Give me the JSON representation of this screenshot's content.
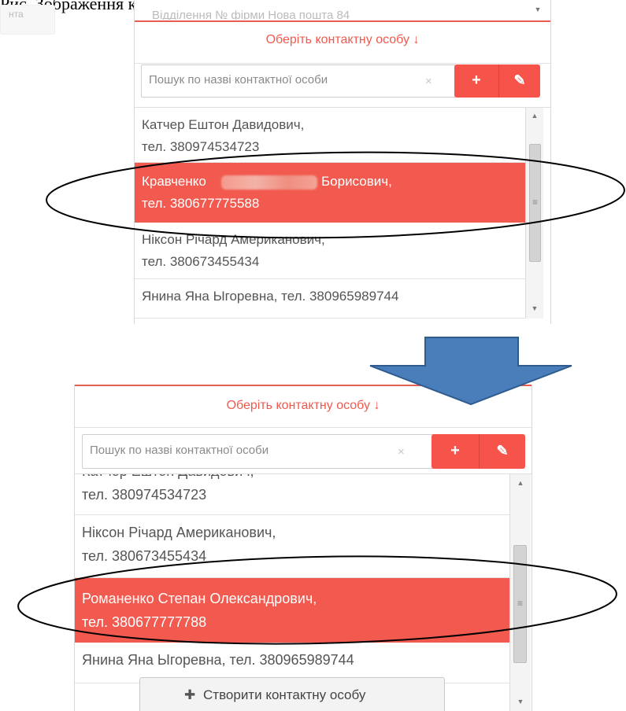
{
  "caption": "Рис. Зображення контактної особи контрагента до і після",
  "left_stub_text": "нта",
  "panel_before": {
    "cut_text": "Відділення № фірми Нова пошта 84",
    "title": "Оберіть контактну особу ↓",
    "search_placeholder": "Пошук по назві контактної особи",
    "clear_icon": "×",
    "add_icon": "+",
    "edit_icon": "✎",
    "contacts": [
      {
        "line1": "Катчер Ештон Давидович,",
        "line2": "тел. 380974534723"
      },
      {
        "line1_a": "Кравченко",
        "line1_b": "Борисович,",
        "line2": "тел. 380677775588"
      },
      {
        "line1": "Ніксон Річард Американович,",
        "line2": "тел. 380673455434"
      },
      {
        "line1": "Янина Яна Ыгоревна, тел. 380965989744"
      }
    ]
  },
  "panel_after": {
    "title": "Оберіть контактну особу ↓",
    "search_placeholder": "Пошук по назві контактної особи",
    "clear_icon": "×",
    "add_icon": "+",
    "edit_icon": "✎",
    "contacts": [
      {
        "line1": "Катчер Ештон Давидович,",
        "line2": "тел. 380974534723"
      },
      {
        "line1": "Ніксон Річард Американович,",
        "line2": "тел. 380673455434"
      },
      {
        "line1": "Романенко Степан Олександрович,",
        "line2": "тел. 380677777788"
      },
      {
        "line1": "Янина Яна Ыгоревна, тел. 380965989744"
      }
    ],
    "create_button": "Створити контактну особу",
    "create_icon": "✚"
  },
  "scroll": {
    "up": "▲",
    "down": "▼",
    "grip": "≡"
  },
  "colors": {
    "accent": "#f25a50",
    "arrow": "#4a7ebb",
    "arrow_border": "#2f5b8f"
  }
}
